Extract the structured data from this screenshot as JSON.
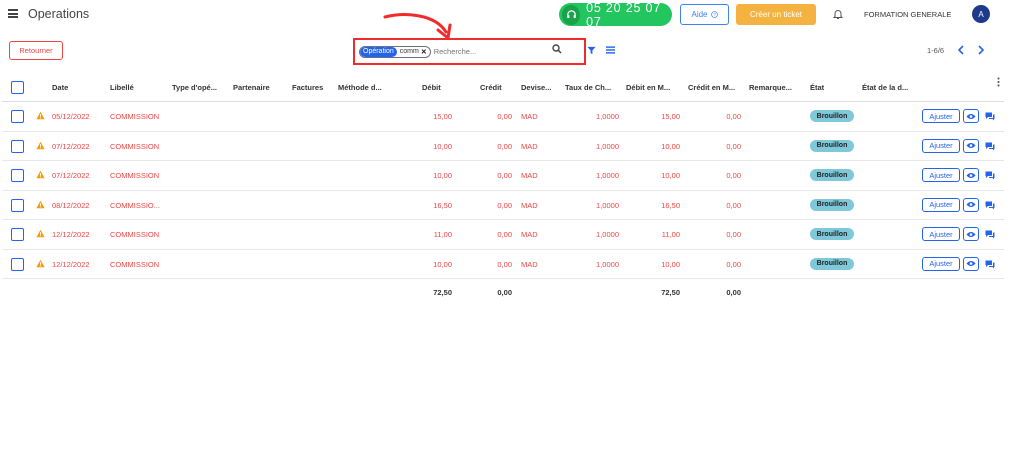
{
  "header": {
    "title": "Operations",
    "phone": "05 20 25 07 07",
    "help_label": "Aide",
    "ticket_label": "Créer un ticket",
    "company": "FORMATION GENERALE",
    "avatar_initial": "A"
  },
  "controls": {
    "back_label": "Retourner",
    "search": {
      "facet_label": "Opération",
      "facet_value": "comm",
      "placeholder": "Recherche..."
    },
    "pager": "1-6/6"
  },
  "table": {
    "columns": [
      "Date",
      "Libellé",
      "Type d'opé...",
      "Partenaire",
      "Factures",
      "Méthode d...",
      "Débit",
      "Crédit",
      "Devise...",
      "Taux de Ch...",
      "Débit en M...",
      "Crédit en M...",
      "Remarque...",
      "État",
      "État de la d..."
    ],
    "rows": [
      {
        "date": "05/12/2022",
        "libelle": "COMMISSION",
        "debit": "15,00",
        "credit": "0,00",
        "devise": "MAD",
        "taux": "1,0000",
        "debit_m": "15,00",
        "credit_m": "0,00",
        "etat": "Brouillon",
        "action": "Ajuster"
      },
      {
        "date": "07/12/2022",
        "libelle": "COMMISSION",
        "debit": "10,00",
        "credit": "0,00",
        "devise": "MAD",
        "taux": "1,0000",
        "debit_m": "10,00",
        "credit_m": "0,00",
        "etat": "Brouillon",
        "action": "Ajuster"
      },
      {
        "date": "07/12/2022",
        "libelle": "COMMISSION",
        "debit": "10,00",
        "credit": "0,00",
        "devise": "MAD",
        "taux": "1,0000",
        "debit_m": "10,00",
        "credit_m": "0,00",
        "etat": "Brouillon",
        "action": "Ajuster"
      },
      {
        "date": "08/12/2022",
        "libelle": "COMMISSIO...",
        "debit": "16,50",
        "credit": "0,00",
        "devise": "MAD",
        "taux": "1,0000",
        "debit_m": "16,50",
        "credit_m": "0,00",
        "etat": "Brouillon",
        "action": "Ajuster"
      },
      {
        "date": "12/12/2022",
        "libelle": "COMMISSION",
        "debit": "11,00",
        "credit": "0,00",
        "devise": "MAD",
        "taux": "1,0000",
        "debit_m": "11,00",
        "credit_m": "0,00",
        "etat": "Brouillon",
        "action": "Ajuster"
      },
      {
        "date": "12/12/2022",
        "libelle": "COMMISSION",
        "debit": "10,00",
        "credit": "0,00",
        "devise": "MAD",
        "taux": "1,0000",
        "debit_m": "10,00",
        "credit_m": "0,00",
        "etat": "Brouillon",
        "action": "Ajuster"
      }
    ],
    "totals": {
      "debit": "72,50",
      "credit": "0,00",
      "debit_m": "72,50",
      "credit_m": "0,00"
    }
  },
  "colors": {
    "accent": "#2563eb",
    "danger": "#ef4444",
    "phone_green": "#22c55e",
    "ticket_orange": "#f4b340",
    "badge_teal": "#7ec8d9",
    "warning": "#f59e0b"
  },
  "icons": [
    "menu-icon",
    "headset-icon",
    "help-circle-icon",
    "bell-icon",
    "search-icon",
    "filter-icon",
    "list-icon",
    "chevron-left-icon",
    "chevron-right-icon",
    "warning-icon",
    "eye-icon",
    "chat-icon",
    "kebab-icon"
  ]
}
